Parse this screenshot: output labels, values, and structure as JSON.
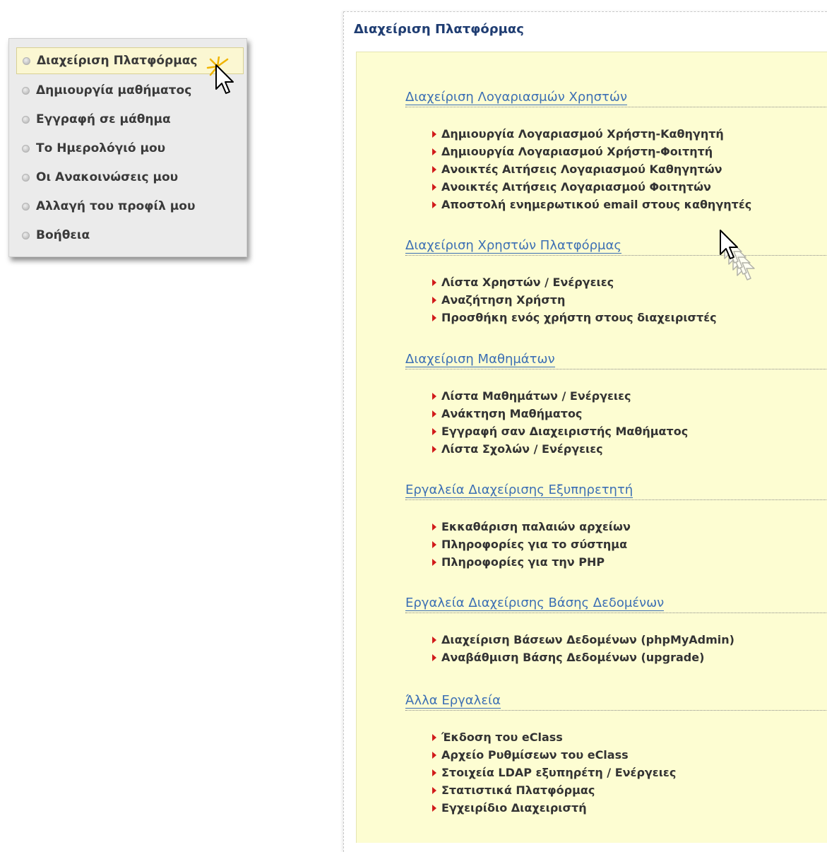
{
  "sidebar": {
    "items": [
      {
        "label": "Διαχείριση Πλατφόρμας",
        "active": true
      },
      {
        "label": "Δημιουργία μαθήματος",
        "active": false
      },
      {
        "label": "Εγγραφή σε μάθημα",
        "active": false
      },
      {
        "label": "Το Ημερολόγιό μου",
        "active": false
      },
      {
        "label": "Οι Ανακοινώσεις μου",
        "active": false
      },
      {
        "label": "Αλλαγή του προφίλ μου",
        "active": false
      },
      {
        "label": "Βοήθεια",
        "active": false
      }
    ]
  },
  "main": {
    "title": "Διαχείριση Πλατφόρμας",
    "sections": [
      {
        "title": "Διαχείριση Λογαριασμών Χρηστών",
        "links": [
          "Δημιουργία Λογαριασμού Χρήστη-Καθηγητή",
          "Δημιουργία Λογαριασμού Χρήστη-Φοιτητή",
          "Ανοικτές Αιτήσεις Λογαριασμού Καθηγητών",
          "Ανοικτές Αιτήσεις Λογαριασμού Φοιτητών",
          "Αποστολή ενημερωτικού email στους καθηγητές"
        ]
      },
      {
        "title": "Διαχείριση Χρηστών Πλατφόρμας",
        "links": [
          "Λίστα Χρηστών / Ενέργειες",
          "Αναζήτηση Χρήστη",
          "Προσθήκη ενός χρήστη στους διαχειριστές"
        ]
      },
      {
        "title": "Διαχείριση Μαθημάτων",
        "links": [
          "Λίστα Μαθημάτων / Ενέργειες",
          "Ανάκτηση Μαθήματος",
          "Εγγραφή σαν Διαχειριστής Μαθήματος",
          "Λίστα Σχολών / Ενέργειες"
        ]
      },
      {
        "title": "Εργαλεία Διαχείρισης Εξυπηρετητή",
        "links": [
          "Εκκαθάριση παλαιών αρχείων",
          "Πληροφορίες για το σύστημα",
          "Πληροφορίες για την PHP"
        ]
      },
      {
        "title": "Εργαλεία Διαχείρισης Βάσης Δεδομένων",
        "links": [
          "Διαχείριση Βάσεων Δεδομένων (phpMyAdmin)",
          "Αναβάθμιση Βάσης Δεδομένων (upgrade)"
        ]
      },
      {
        "title": "Άλλα Εργαλεία",
        "links": [
          "Έκδοση του eClass",
          "Αρχείο Ρυθμίσεων του eClass",
          "Στοιχεία LDAP εξυπηρέτη / Ενέργειες",
          "Στατιστικά Πλατφόρμας",
          "Εγχειρίδιο Διαχειριστή"
        ]
      }
    ]
  },
  "colors": {
    "section_title": "#3c6fb4",
    "main_title": "#1f3d72",
    "content_bg": "#fdfdd2",
    "active_item_bg": "#fbf7d2",
    "link_arrow": "#d11b1b"
  },
  "icons": {
    "sidebar_bullet": "grey-circle-bullet-icon",
    "link_bullet": "red-triangle-arrow-icon",
    "cursor": "mouse-pointer-icon"
  }
}
